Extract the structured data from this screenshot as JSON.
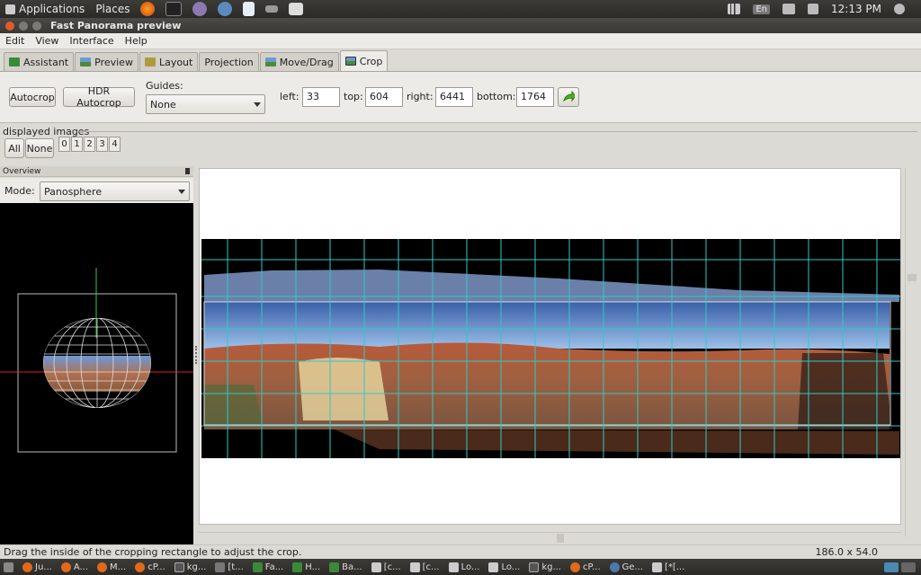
{
  "system": {
    "applications": "Applications",
    "places": "Places",
    "lang": "En",
    "clock": "12:13 PM"
  },
  "window": {
    "title": "Fast Panorama preview"
  },
  "menu": [
    "Edit",
    "View",
    "Interface",
    "Help"
  ],
  "tabs": [
    {
      "label": "Assistant",
      "icon": "wand-icon",
      "color": "#3a8a3a"
    },
    {
      "label": "Preview",
      "icon": "landscape-icon",
      "color": "#4a7ab0"
    },
    {
      "label": "Layout",
      "icon": "layout-icon",
      "color": "#b09a40"
    },
    {
      "label": "Projection",
      "icon": "",
      "color": ""
    },
    {
      "label": "Move/Drag",
      "icon": "move-icon",
      "color": "#4a7ab0"
    },
    {
      "label": "Crop",
      "icon": "crop-icon",
      "color": "#4a7ab0"
    }
  ],
  "crop": {
    "autocrop": "Autocrop",
    "hdr_autocrop": "HDR Autocrop",
    "guides_label": "Guides:",
    "guides_value": "None",
    "left_label": "left:",
    "left": "33",
    "top_label": "top:",
    "top": "604",
    "right_label": "right:",
    "right": "6441",
    "bottom_label": "bottom:",
    "bottom": "1764"
  },
  "displayed": {
    "caption": "displayed images",
    "all": "All",
    "none": "None",
    "images": [
      "0",
      "1",
      "2",
      "3",
      "4"
    ]
  },
  "overview": {
    "title": "Overview",
    "mode_label": "Mode:",
    "mode_value": "Panosphere"
  },
  "status": {
    "message": "Drag the inside of the cropping rectangle to adjust the crop.",
    "dimensions": "186.0 x 54.0"
  },
  "taskbar": [
    {
      "label": "Ju...",
      "color": "#e06a1a"
    },
    {
      "label": "A...",
      "color": "#e06a1a"
    },
    {
      "label": "M...",
      "color": "#e06a1a"
    },
    {
      "label": "cP...",
      "color": "#e06a1a"
    },
    {
      "label": "kg...",
      "color": "#777777"
    },
    {
      "label": "[t...",
      "color": "#777777"
    },
    {
      "label": "Fa...",
      "color": "#3a8a3a"
    },
    {
      "label": "H...",
      "color": "#3a8a3a"
    },
    {
      "label": "Ba...",
      "color": "#3a8a3a"
    },
    {
      "label": "[c...",
      "color": "#cccccc"
    },
    {
      "label": "[c...",
      "color": "#cccccc"
    },
    {
      "label": "Lo...",
      "color": "#cccccc"
    },
    {
      "label": "Lo...",
      "color": "#cccccc"
    },
    {
      "label": "kg...",
      "color": "#777777"
    },
    {
      "label": "cP...",
      "color": "#e06a1a"
    },
    {
      "label": "Ge...",
      "color": "#4a7ab0"
    },
    {
      "label": "[*[...",
      "color": "#cccccc"
    }
  ]
}
